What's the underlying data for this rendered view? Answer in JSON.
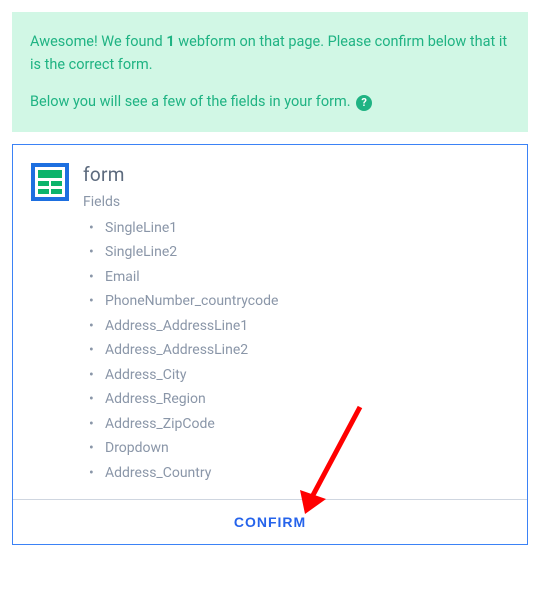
{
  "alert": {
    "line1_pre": "Awesome! We found ",
    "count": "1",
    "line1_post": " webform on that page. Please confirm below that it is the correct form.",
    "line2": "Below you will see a few of the fields in your form. "
  },
  "form": {
    "title": "form",
    "fields_label": "Fields",
    "fields": [
      "SingleLine1",
      "SingleLine2",
      "Email",
      "PhoneNumber_countrycode",
      "Address_AddressLine1",
      "Address_AddressLine2",
      "Address_City",
      "Address_Region",
      "Address_ZipCode",
      "Dropdown",
      "Address_Country"
    ]
  },
  "confirm_label": "CONFIRM"
}
